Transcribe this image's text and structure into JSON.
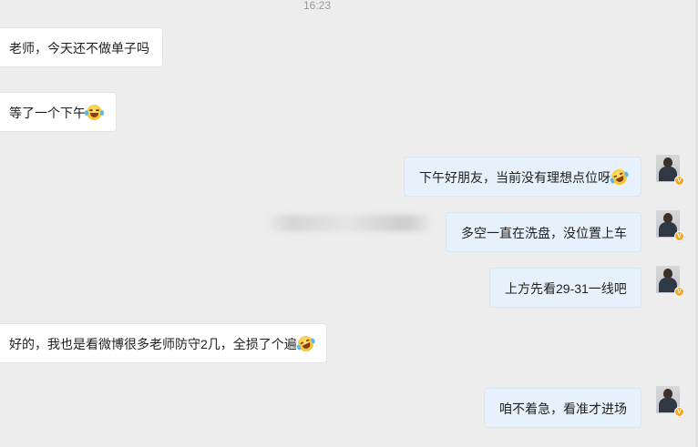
{
  "conversation": {
    "timestamp": "16:23",
    "messages": [
      {
        "id": "m1",
        "side": "in",
        "text": "老师，今天还不做单子吗",
        "emoji": null
      },
      {
        "id": "m2",
        "side": "in",
        "text": "等了一个下午",
        "emoji": "laughing-tears"
      },
      {
        "id": "m3",
        "side": "out",
        "text": "下午好朋友，当前没有理想点位呀",
        "emoji": "rolling-laughing"
      },
      {
        "id": "m4",
        "side": "out",
        "text": "多空一直在洗盘，没位置上车",
        "emoji": null
      },
      {
        "id": "m5",
        "side": "out",
        "text": "上方先看29-31一线吧",
        "emoji": null
      },
      {
        "id": "m6",
        "side": "in",
        "text": "好的，我也是看微博很多老师防守2几，全损了个遍",
        "emoji": "rolling-laughing"
      },
      {
        "id": "m7",
        "side": "out",
        "text": "咱不着急，看准才进场",
        "emoji": null
      }
    ]
  },
  "avatar": {
    "badge": "V",
    "badge_color": "#f5a623"
  },
  "colors": {
    "background": "#ededed",
    "incoming_bubble": "#ffffff",
    "outgoing_bubble": "#e6f1fb"
  }
}
